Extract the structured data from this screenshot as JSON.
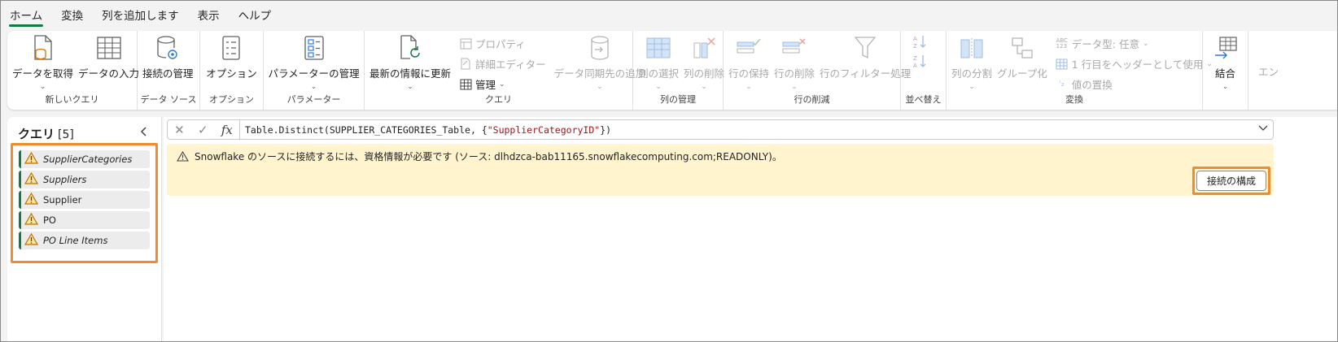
{
  "tabs": [
    "ホーム",
    "変換",
    "列を追加します",
    "表示",
    "ヘルプ"
  ],
  "ribbon": {
    "groups": {
      "new_query": {
        "label": "新しいクエリ",
        "get_data": "データを取得",
        "enter_data": "データの入力"
      },
      "data_source": {
        "label": "データ ソース",
        "manage_connections": "接続の管理"
      },
      "options": {
        "label": "オプション",
        "options": "オプション"
      },
      "parameters": {
        "label": "パラメーター",
        "manage_parameters": "パラメーターの管理"
      },
      "query": {
        "label": "クエリ",
        "refresh": "最新の情報に更新",
        "properties": "プロパティ",
        "advanced_editor": "詳細エディター",
        "manage": "管理",
        "add_destination": "データ同期先の追加"
      },
      "manage_columns": {
        "label": "列の管理",
        "choose_columns": "列の選択",
        "remove_columns": "列の削除"
      },
      "reduce_rows": {
        "label": "行の削減",
        "keep_rows": "行の保持",
        "remove_rows": "行の削除",
        "filter_rows": "行のフィルター処理"
      },
      "sort": {
        "label": "並べ替え"
      },
      "transform": {
        "label": "変換",
        "split_column": "列の分割",
        "group_by": "グループ化",
        "data_type": "データ型: 任意",
        "first_row_headers": "1 行目をヘッダーとして使用",
        "replace_values": "値の置換"
      },
      "combine": {
        "label": "結合"
      },
      "overflow": "エン"
    }
  },
  "queries_panel": {
    "title": "クエリ",
    "count": "[5]",
    "items": [
      {
        "name": "SupplierCategories"
      },
      {
        "name": "Suppliers"
      },
      {
        "name": "Supplier"
      },
      {
        "name": "PO"
      },
      {
        "name": "PO Line Items"
      }
    ]
  },
  "formula_bar": {
    "fx": "fx",
    "formula_prefix": "Table.Distinct(SUPPLIER_CATEGORIES_Table, {",
    "formula_string": "\"SupplierCategoryID\"",
    "formula_suffix": "})"
  },
  "warning": {
    "message": "Snowflake のソースに接続するには、資格情報が必要です (ソース: dlhdzca-bab11165.snowflakecomputing.com;READONLY)。",
    "configure_button": "接続の構成"
  },
  "colors": {
    "accent": "#107c41",
    "highlight": "#f08c2d",
    "warning_bg": "#fff4ce"
  }
}
